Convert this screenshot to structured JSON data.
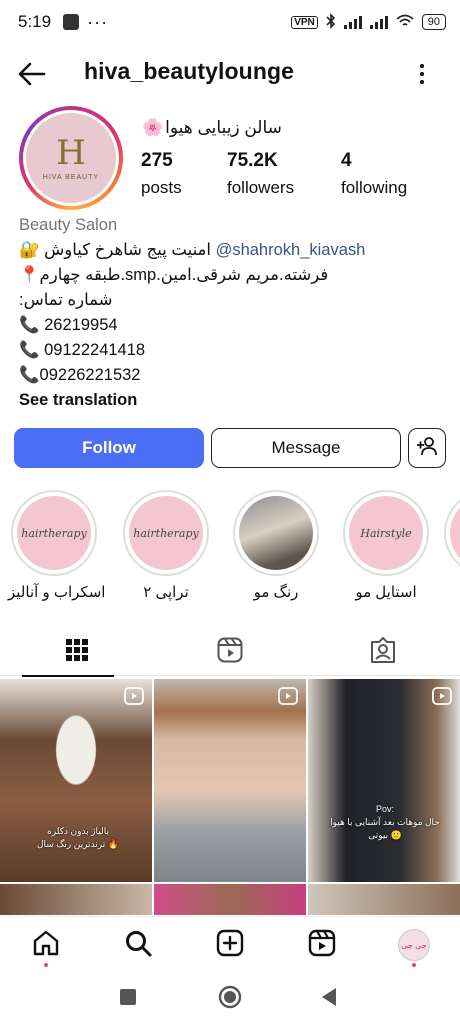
{
  "status_bar": {
    "time": "5:19",
    "dots": "···",
    "vpn": "VPN",
    "battery": "90"
  },
  "header": {
    "username": "hiva_beautylounge"
  },
  "profile": {
    "avatar": {
      "monogram": "H",
      "brand": "HIVA BEAUTY"
    },
    "full_name": "سالن زیبایی هیوا",
    "full_name_emoji": "🌸",
    "stats": [
      {
        "value": "275",
        "label": "posts"
      },
      {
        "value": "75.2K",
        "label": "followers"
      },
      {
        "value": "4",
        "label": "following"
      }
    ],
    "category": "Beauty Salon",
    "bio_lines": [
      {
        "prefix": "🔐",
        "text": "امنیت پیج شاهرخ کیاوش",
        "mention": "@shahrokh_kiavash"
      },
      {
        "prefix": "📍",
        "text": "طبقه چهارم.smp.فرشته.مریم شرقی.امین"
      },
      {
        "prefix": "",
        "text": ":شماره تماس"
      },
      {
        "prefix": "📞",
        "text": " 26219954"
      },
      {
        "prefix": "📞",
        "text": " 09122241418"
      },
      {
        "prefix": "📞",
        "text": "09226221532"
      }
    ],
    "see_translation": "See translation"
  },
  "actions": {
    "follow": "Follow",
    "message": "Message",
    "add_user_icon": "add-person-icon"
  },
  "highlights": [
    {
      "label": "اسکراب و آنالیز",
      "cover_text": "hairtherapy"
    },
    {
      "label": "تراپی ۲",
      "cover_text": "hairtherapy"
    },
    {
      "label": "رنگ مو",
      "cover_text": ""
    },
    {
      "label": "استایل مو",
      "cover_text": "Hairstyle"
    },
    {
      "label": "",
      "cover_text": ""
    }
  ],
  "tabs": [
    {
      "icon": "grid-icon",
      "active": true
    },
    {
      "icon": "reels-icon",
      "active": false
    },
    {
      "icon": "tagged-icon",
      "active": false
    }
  ],
  "posts": [
    {
      "caption_1": "بالیاژ بدون دکلره",
      "caption_2": "ترندترین رنگ سال 🔥"
    },
    {
      "caption_1": "",
      "caption_2": ""
    },
    {
      "caption_1": "Pov:",
      "caption_2": "حال موهات بعد آشنایی با هیوا بیوتی 🙂"
    }
  ],
  "bottom_nav": [
    "home-icon",
    "search-icon",
    "create-icon",
    "reels-icon",
    "profile-avatar"
  ],
  "profile_avatar_text": "جی جی"
}
